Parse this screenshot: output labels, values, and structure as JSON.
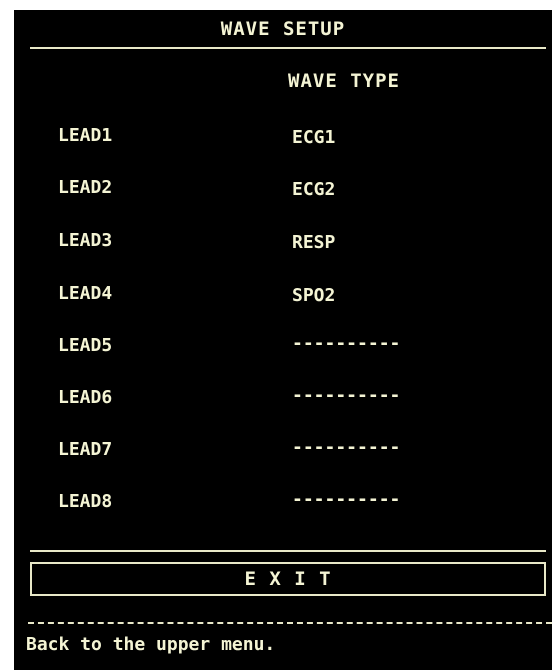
{
  "window": {
    "title": "WAVE SETUP"
  },
  "table": {
    "column_header": "WAVE TYPE",
    "rows": [
      {
        "lead": "LEAD1",
        "wave": "ECG1"
      },
      {
        "lead": "LEAD2",
        "wave": "ECG2"
      },
      {
        "lead": "LEAD3",
        "wave": "RESP"
      },
      {
        "lead": "LEAD4",
        "wave": "SPO2"
      },
      {
        "lead": "LEAD5",
        "wave": "----------"
      },
      {
        "lead": "LEAD6",
        "wave": "----------"
      },
      {
        "lead": "LEAD7",
        "wave": "----------"
      },
      {
        "lead": "LEAD8",
        "wave": "----------"
      }
    ]
  },
  "exit_button": {
    "label": "E X I T"
  },
  "status_bar": {
    "help_text": "Back to the upper menu."
  },
  "colors": {
    "background": "#000000",
    "foreground": "#f4f4d4"
  }
}
